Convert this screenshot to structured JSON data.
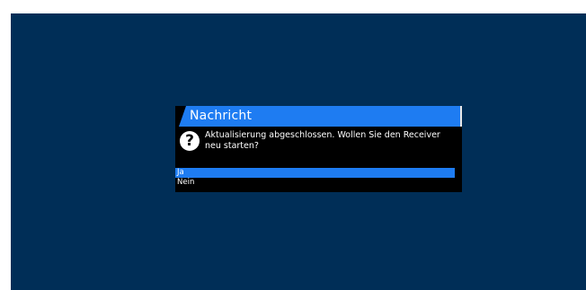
{
  "dialog": {
    "title": "Nachricht",
    "icon": "question-icon",
    "icon_glyph": "?",
    "message": "Aktualisierung abgeschlossen. Wollen Sie den Receiver neu starten?",
    "options": [
      {
        "label": "Ja",
        "selected": true
      },
      {
        "label": "Nein",
        "selected": false
      }
    ]
  },
  "colors": {
    "background": "#002e57",
    "accent": "#1e7cf2",
    "dialog_bg": "#000000"
  }
}
